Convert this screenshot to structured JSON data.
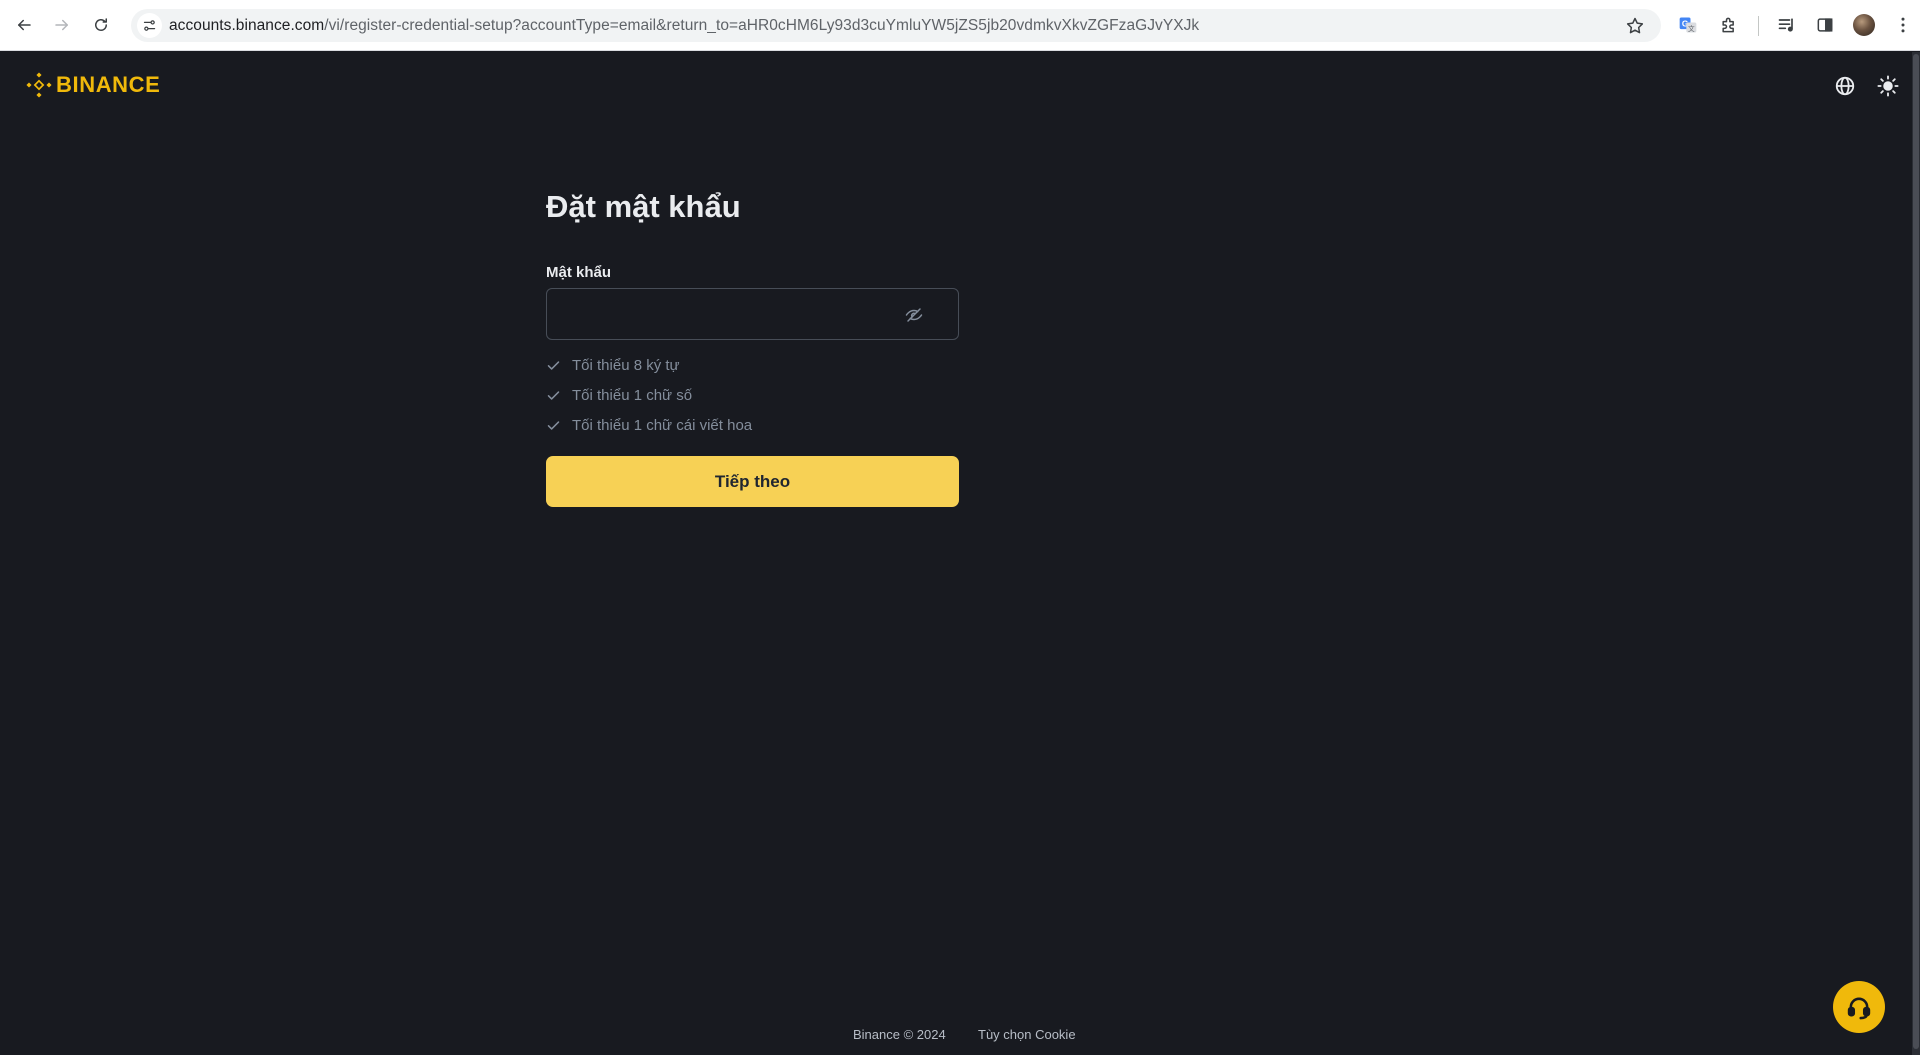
{
  "browser": {
    "url_host": "accounts.binance.com",
    "url_path": "/vi/register-credential-setup?accountType=email&return_to=aHR0cHM6Ly93d3cuYmluYW5jZS5jb20vdmkvXkvZGFzaGJvYXJk",
    "icons": [
      "back-arrow-icon",
      "forward-arrow-icon",
      "reload-icon",
      "site-info-icon",
      "bookmark-star-icon",
      "translate-icon",
      "extensions-icon",
      "media-queue-icon",
      "side-panel-icon",
      "profile-avatar",
      "kebab-menu-icon"
    ]
  },
  "header": {
    "logo_text": "BINANCE",
    "brand_color": "#f0b90b",
    "icons": [
      "globe-icon",
      "theme-sun-icon"
    ]
  },
  "form": {
    "title": "Đặt mật khẩu",
    "password_label": "Mật khẩu",
    "password_value": "",
    "toggle_icon": "eye-slash-icon",
    "rules": [
      {
        "text": "Tối thiểu 8 ký tự"
      },
      {
        "text": "Tối thiểu 1 chữ số"
      },
      {
        "text": "Tối thiểu 1 chữ cái viết hoa"
      }
    ],
    "next_label": "Tiếp theo",
    "button_color": "#f7d155"
  },
  "footer": {
    "copyright": "Binance © 2024",
    "cookie_link": "Tùy chọn Cookie"
  },
  "support": {
    "icon": "headset-icon"
  }
}
